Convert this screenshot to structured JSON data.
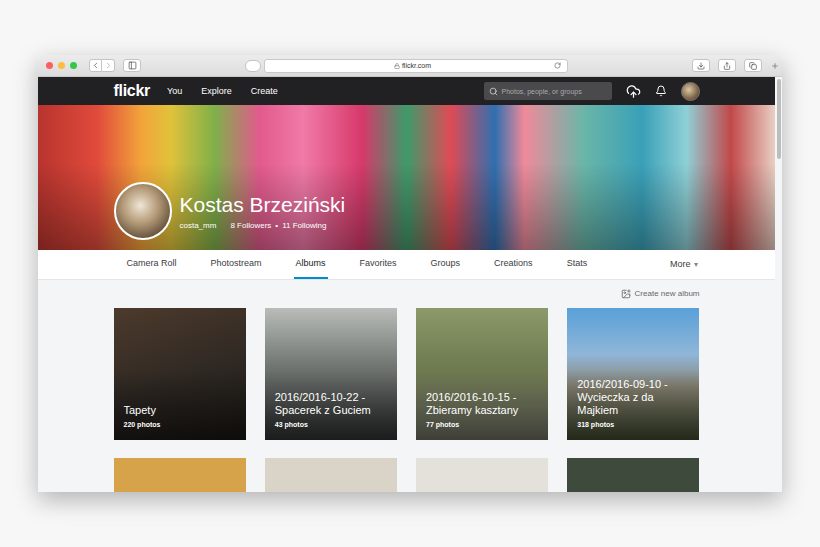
{
  "browser": {
    "url": "flickr.com"
  },
  "nav": {
    "logo": "flickr",
    "links": [
      "You",
      "Explore",
      "Create"
    ],
    "search_placeholder": "Photos, people, or groups"
  },
  "profile": {
    "name": "Kostas Brzeziński",
    "username": "costa_mm",
    "followers": "8 Followers",
    "separator": "•",
    "following": "11 Following"
  },
  "tabs": [
    {
      "label": "Camera Roll",
      "selected": false
    },
    {
      "label": "Photostream",
      "selected": false
    },
    {
      "label": "Albums",
      "selected": true
    },
    {
      "label": "Favorites",
      "selected": false
    },
    {
      "label": "Groups",
      "selected": false
    },
    {
      "label": "Creations",
      "selected": false
    },
    {
      "label": "Stats",
      "selected": false
    }
  ],
  "more": {
    "label": "More",
    "caret": "▾"
  },
  "create_album": "Create new album",
  "albums": [
    {
      "title": "Tapety",
      "count": "220 photos"
    },
    {
      "title": "2016/2016-10-22 - Spacerek z Guciem",
      "count": "43 photos"
    },
    {
      "title": "2016/2016-10-15 - Zbieramy kasztany",
      "count": "77 photos"
    },
    {
      "title": "2016/2016-09-10 - Wycieczka z da Majkiem",
      "count": "318 photos"
    }
  ]
}
